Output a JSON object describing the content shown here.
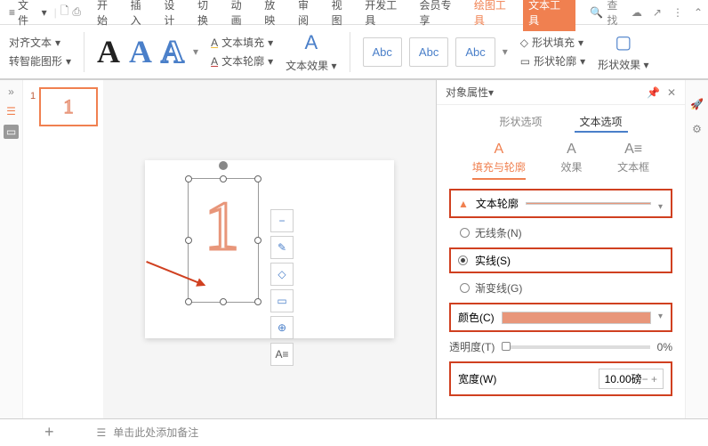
{
  "top": {
    "menu": "文件",
    "tabs": [
      "开始",
      "插入",
      "设计",
      "切换",
      "动画",
      "放映",
      "审阅",
      "视图",
      "开发工具",
      "会员专享",
      "绘图工具",
      "文本工具"
    ],
    "search": "查找"
  },
  "ribbon": {
    "align": "对齐文本",
    "smart": "转智能图形",
    "textfill": "文本填充",
    "textoutline": "文本轮廓",
    "texteffect": "文本效果",
    "abc": "Abc",
    "shapefill": "形状填充",
    "shapeoutline": "形状轮廓",
    "shapeeffect": "形状效果"
  },
  "slide": {
    "num": "1",
    "char": "1"
  },
  "props": {
    "title": "对象属性",
    "tab_shape": "形状选项",
    "tab_text": "文本选项",
    "sub_fill": "填充与轮廓",
    "sub_effect": "效果",
    "sub_box": "文本框",
    "section_outline": "文本轮廓",
    "opt_none": "无线条(N)",
    "opt_solid": "实线(S)",
    "opt_grad": "渐变线(G)",
    "color": "颜色(C)",
    "opacity": "透明度(T)",
    "opacity_val": "0%",
    "width": "宽度(W)",
    "width_val": "10.00磅"
  },
  "status": {
    "notes": "单击此处添加备注"
  }
}
